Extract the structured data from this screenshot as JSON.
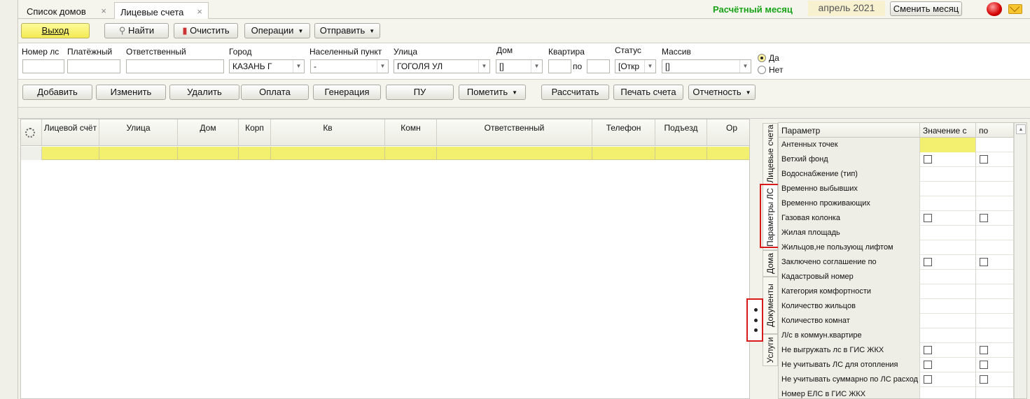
{
  "tabs": [
    {
      "label": "Список домов",
      "close": "×"
    },
    {
      "label": "Лицевые счета",
      "close": "×"
    }
  ],
  "header": {
    "month_label": "Расчётный месяц",
    "month_value": "апрель 2021",
    "change_month": "Сменить месяц"
  },
  "toolbar": {
    "exit": "Выход",
    "find": "Найти",
    "clear": "Очистить",
    "operations": "Операции",
    "send": "Отправить"
  },
  "filters": {
    "account_no": {
      "label": "Номер лс",
      "value": ""
    },
    "payer": {
      "label": "Платёжный",
      "value": ""
    },
    "responsible": {
      "label": "Ответственный",
      "value": ""
    },
    "city": {
      "label": "Город",
      "value": "КАЗАНЬ Г"
    },
    "locality": {
      "label": "Населенный пункт",
      "value": "-"
    },
    "street": {
      "label": "Улица",
      "value": "ГОГОЛЯ УЛ"
    },
    "house": {
      "label": "Дом",
      "value": "[]"
    },
    "flat": {
      "label": "Квартира",
      "to": "по",
      "from_value": "",
      "to_value": ""
    },
    "status": {
      "label": "Статус",
      "value": "[Откр"
    },
    "array": {
      "label": "Массив",
      "value": "[]"
    },
    "radio_yes": "Да",
    "radio_no": "Нет",
    "radio_selected": "Да"
  },
  "actions": {
    "add": "Добавить",
    "edit": "Изменить",
    "delete": "Удалить",
    "payment": "Оплата",
    "generate": "Генерация",
    "pu": "ПУ",
    "mark": "Пометить",
    "calculate": "Рассчитать",
    "print": "Печать счета",
    "report": "Отчетность"
  },
  "grid": {
    "columns": [
      "Лицевой счёт",
      "Улица",
      "Дом",
      "Корп",
      "Кв",
      "Комн",
      "Ответственный",
      "Телефон",
      "Подъезд",
      "Ор"
    ]
  },
  "side_tabs": [
    "Лицевые счета",
    "Параметры ЛС",
    "Дома",
    "Документы",
    "Услуги"
  ],
  "params": {
    "headers": [
      "Параметр",
      "Значение с",
      "по"
    ],
    "rows": [
      {
        "name": "Антенных точек",
        "check": false
      },
      {
        "name": "Ветхий фонд",
        "check": true
      },
      {
        "name": "Водоснабжение (тип)",
        "check": false
      },
      {
        "name": "Временно выбывших",
        "check": false
      },
      {
        "name": "Временно проживающих",
        "check": false
      },
      {
        "name": "Газовая колонка",
        "check": true
      },
      {
        "name": "Жилая площадь",
        "check": false
      },
      {
        "name": "Жильцов,не пользующ лифтом",
        "check": false
      },
      {
        "name": "Заключено соглашение по",
        "check": true
      },
      {
        "name": "Кадастровый номер",
        "check": false
      },
      {
        "name": "Категория комфортности",
        "check": false
      },
      {
        "name": "Количество жильцов",
        "check": false
      },
      {
        "name": "Количество комнат",
        "check": false
      },
      {
        "name": "Л/с в коммун.квартире",
        "check": false
      },
      {
        "name": "Не выгружать лс в ГИС ЖКХ",
        "check": true
      },
      {
        "name": "Не учитывать ЛС для отопления",
        "check": true
      },
      {
        "name": "Не учитывать суммарно по ЛС расход",
        "check": true
      },
      {
        "name": "Номер ЕЛС в ГИС ЖКХ",
        "check": false
      }
    ]
  },
  "colors": {
    "accent_yellow": "#f3f070",
    "month_green": "#17a317",
    "highlight_red": "#d71a1a"
  }
}
